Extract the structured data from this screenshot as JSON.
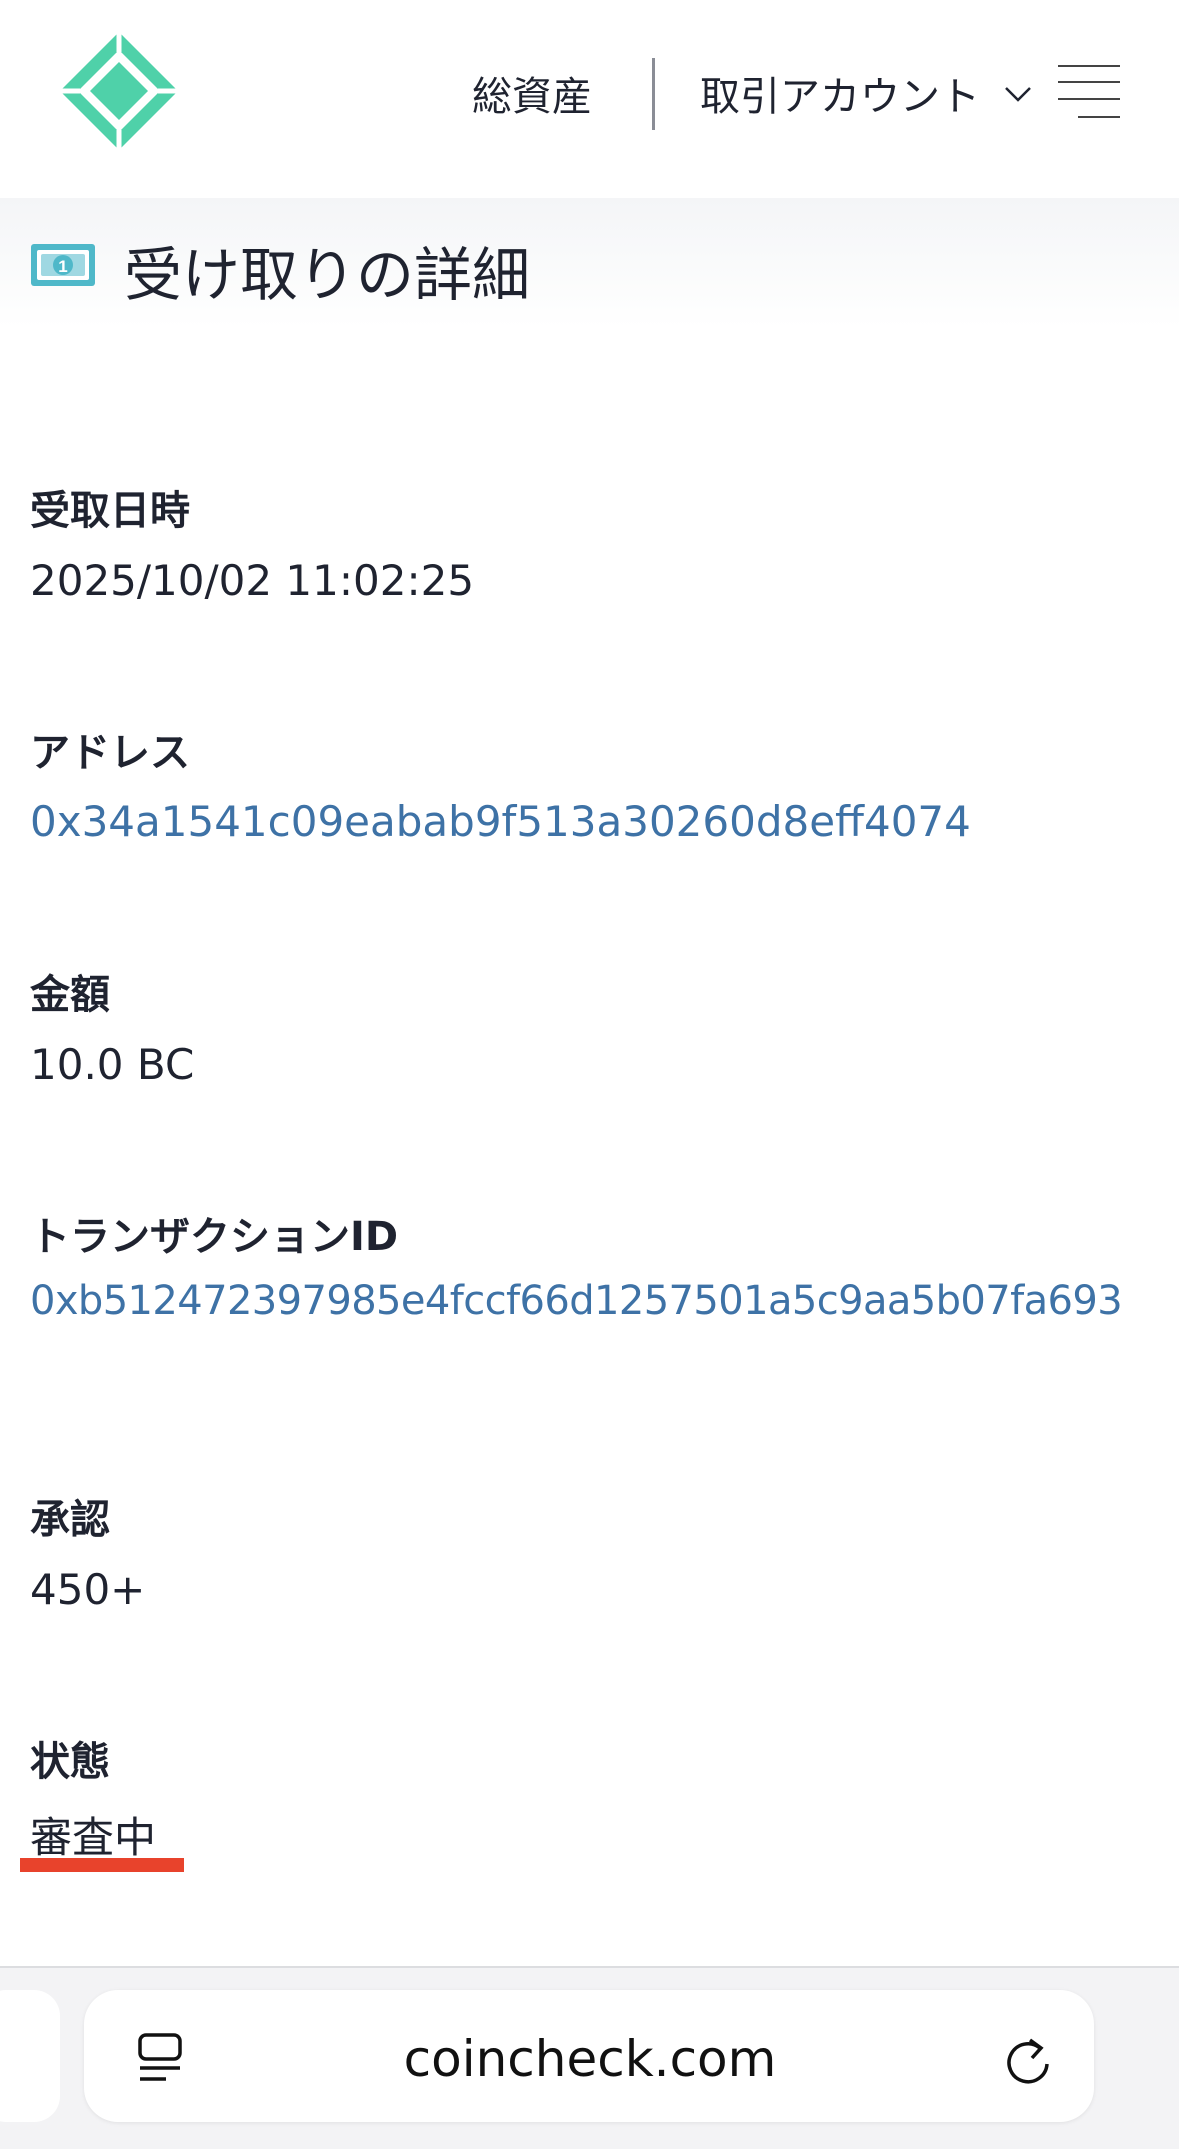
{
  "header": {
    "total_assets": "総資産",
    "account_menu": "取引アカウント",
    "colors": {
      "logo": "#4fd1a9",
      "text": "#1f2330"
    }
  },
  "page": {
    "title": "受け取りの詳細"
  },
  "details": {
    "received_at": {
      "label": "受取日時",
      "value": "2025/10/02 11:02:25"
    },
    "address": {
      "label": "アドレス",
      "value": "0x34a1541c09eabab9f513a30260d8eff4074"
    },
    "amount": {
      "label": "金額",
      "value": "10.0 BC"
    },
    "transaction_id": {
      "label": "トランザクションID",
      "value": "0xb512472397985e4fccf66d1257501a5c9aa5b07fa693"
    },
    "confirmations": {
      "label": "承認",
      "value": "450+"
    },
    "status": {
      "label": "状態",
      "value": "審査中"
    }
  },
  "browser": {
    "url": "coincheck.com"
  },
  "colors": {
    "link": "#3e72a6",
    "highlight_underline": "#e8432c"
  }
}
